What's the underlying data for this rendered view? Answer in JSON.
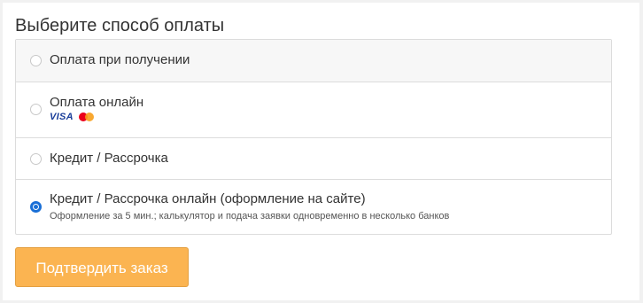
{
  "heading": "Выберите способ оплаты",
  "payment_options": [
    {
      "label": "Оплата при получении",
      "selected": false,
      "hovered": true
    },
    {
      "label": "Оплата онлайн",
      "selected": false,
      "cards": {
        "visa": "VISA",
        "icons": [
          "visa-icon",
          "mastercard-icon"
        ]
      }
    },
    {
      "label": "Кредит / Рассрочка",
      "selected": false
    },
    {
      "label": "Кредит / Рассрочка онлайн (оформление на сайте)",
      "sublabel": "Оформление за 5 мин.; калькулятор и подача заявки одновременно в несколько банков",
      "selected": true
    }
  ],
  "confirm_button": {
    "label": "Подтвердить заказ"
  },
  "colors": {
    "accent_radio": "#1a6fd6",
    "button_bg": "#fbb451",
    "border": "#dcdcdc"
  }
}
